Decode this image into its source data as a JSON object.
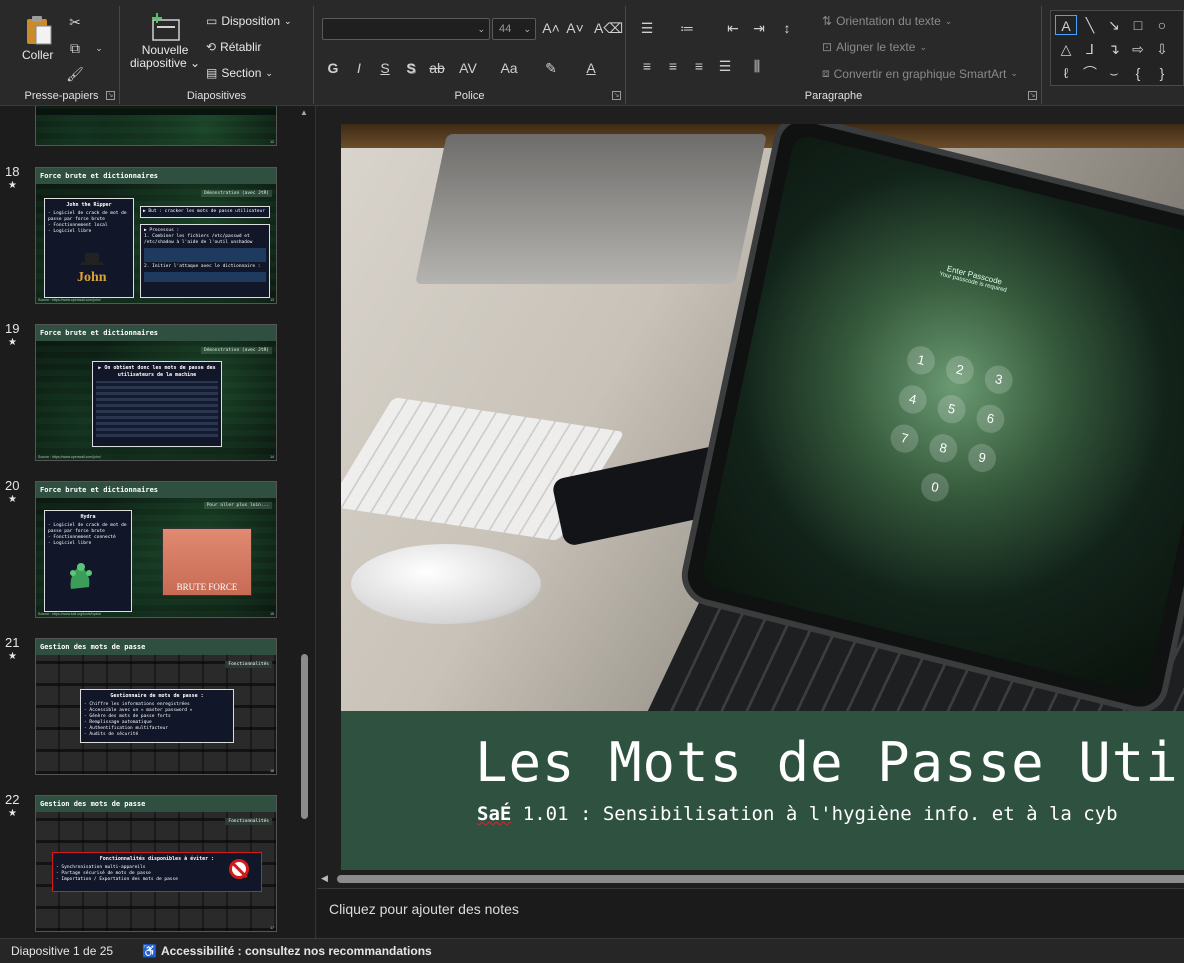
{
  "ribbon": {
    "clipboard": {
      "label": "Presse-papiers",
      "paste": "Coller",
      "icons": [
        "scissors-icon",
        "copy-icon",
        "format-painter-icon"
      ]
    },
    "slides": {
      "label": "Diapositives",
      "new_slide_line1": "Nouvelle",
      "new_slide_line2": "diapositive",
      "layout": "Disposition",
      "reset": "Rétablir",
      "section": "Section"
    },
    "font": {
      "label": "Police",
      "font_name": "",
      "font_size": "44",
      "bold": "G",
      "italic": "I",
      "underline": "S",
      "shadow": "S",
      "strike": "ab",
      "spacing": "AV",
      "case": "Aa"
    },
    "paragraph": {
      "label": "Paragraphe",
      "text_direction": "Orientation du texte",
      "align_text": "Aligner le texte",
      "smartart": "Convertir en graphique SmartArt"
    }
  },
  "thumbnails": [
    {
      "num": "18",
      "star": "★",
      "title": "Force brute et dictionnaires",
      "sub": "Démonstration (avec JtR)",
      "box1_title": "John the Ripper",
      "box1_lines": [
        "- Logiciel de crack de mot de passe par force brute",
        "- Fonctionnement local",
        "- Logiciel libre"
      ],
      "box2_title": "▶ But : cracker les mots de passe utilisateur",
      "box3_lines": [
        "▶ Processus :",
        "1. Combiner les fichiers /etc/passwd et /etc/shadow à l'aide de l'outil unshadow",
        "2. Initier l'attaque avec le dictionnaire :"
      ],
      "footer": "Source : https://www.openwall.com/john/",
      "page": "13"
    },
    {
      "num": "19",
      "star": "★",
      "title": "Force brute et dictionnaires",
      "sub": "Démonstration (avec JtR)",
      "box1_title": "▶ On obtient donc les mots de passe des utilisateurs de la machine",
      "footer": "Source : https://www.openwall.com/john/",
      "page": "14"
    },
    {
      "num": "20",
      "star": "★",
      "title": "Force brute et dictionnaires",
      "sub": "Pour aller plus loin...",
      "box1_title": "Hydra",
      "box1_lines": [
        "- Logiciel de crack de mot de passe par force brute",
        "- Fonctionnement connecté",
        "- Logiciel libre"
      ],
      "gun_label": "BRUTE FORCE",
      "footer": "Source : https://www.kali.org/tools/hydra/",
      "page": "15"
    },
    {
      "num": "21",
      "star": "★",
      "title": "Gestion des mots de passe",
      "sub": "Fonctionnalités",
      "box1_title": "Gestionnaire de mots de passe :",
      "box1_lines": [
        "- Chiffre les informations enregistrées",
        "- Accessible avec un « master password »",
        "- Génère des mots de passe forts",
        "- Remplissage automatique",
        "- Authentification multifacteur",
        "- Audits de sécurité"
      ],
      "page": "16"
    },
    {
      "num": "22",
      "star": "★",
      "title": "Gestion des mots de passe",
      "sub": "Fonctionnalités",
      "box1_title": "Fonctionnalités disponibles à éviter :",
      "box1_lines": [
        "- Synchronisation multi-appareils",
        "- Partage sécurisé de mots de passe",
        "- Importation / Exportation des mots de passe"
      ],
      "page": "17"
    }
  ],
  "slide": {
    "title": "Les Mots de Passe Uti",
    "subtitle_prefix": "SaÉ",
    "subtitle_rest": " 1.01 : Sensibilisation à l'hygiène info. et à la cyb",
    "tablet_text": "Enter Passcode",
    "tablet_sub": "Your passcode is required",
    "keypad": [
      "1",
      "2",
      "3",
      "4",
      "5",
      "6",
      "7",
      "8",
      "9",
      "0"
    ]
  },
  "notes": {
    "placeholder": "Cliquez pour ajouter des notes"
  },
  "status": {
    "slide_counter": "Diapositive 1 de 25",
    "accessibility": "Accessibilité : consultez nos recommandations"
  },
  "colors": {
    "accent_green": "#2e5140",
    "ribbon_bg": "#292929"
  }
}
